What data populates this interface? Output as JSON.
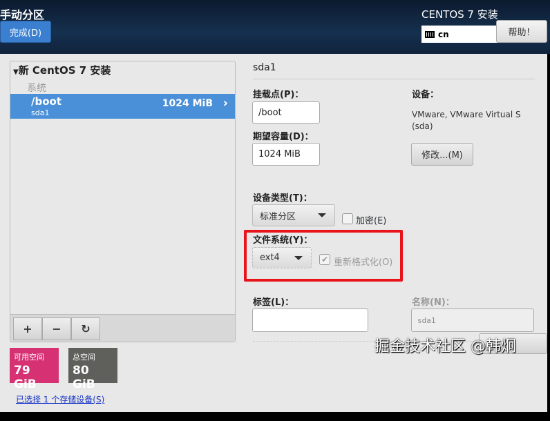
{
  "header": {
    "title": "手动分区",
    "done_label": "完成(D)",
    "os_title": "CENTOS 7 安装",
    "keyboard_layout": "cn",
    "help_label": "帮助！"
  },
  "left": {
    "group": "新 CentOS 7 安装",
    "section": "系统",
    "partitions": [
      {
        "mount": "/boot",
        "device": "sda1",
        "size": "1024 MiB"
      }
    ],
    "toolbar": {
      "add": "+",
      "remove": "−",
      "refresh": "↻"
    },
    "available": {
      "label": "可用空间",
      "value": "79 GiB"
    },
    "total": {
      "label": "总空间",
      "value": "80 GiB"
    },
    "storage_link": "已选择 1 个存储设备(S)"
  },
  "right": {
    "heading": "sda1",
    "mount_label": "挂载点(P)：",
    "mount_value": "/boot",
    "capacity_label": "期望容量(D)：",
    "capacity_value": "1024 MiB",
    "device_label": "设备：",
    "device_value": "VMware, VMware Virtual S (sda)",
    "modify_label": "修改...(M)",
    "device_type_label": "设备类型(T)：",
    "device_type_value": "标准分区",
    "encrypt_label": "加密(E)",
    "fs_label": "文件系统(Y)：",
    "fs_value": "ext4",
    "reformat_label": "重新格式化(O)",
    "tag_label": "标签(L)：",
    "tag_value": "",
    "name_label": "名称(N)：",
    "name_value": "sda1"
  },
  "watermark": "掘金技术社区 @韩炯",
  "colors": {
    "available": "#d63173",
    "total": "#5f5f5b",
    "highlight": "#e8131b",
    "selection": "#4a90d9"
  }
}
